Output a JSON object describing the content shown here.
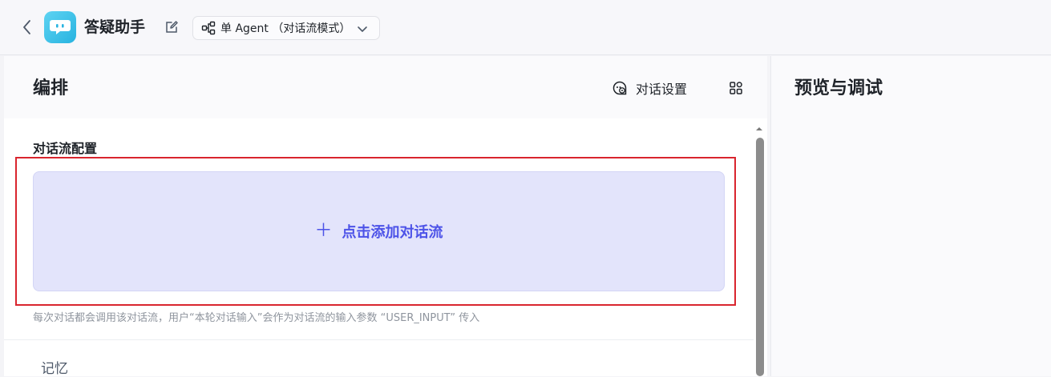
{
  "header": {
    "app_title": "答疑助手",
    "mode_label": "单 Agent （对话流模式）",
    "icons": {
      "back": "chevron-left-icon",
      "logo": "chat-bubble-logo",
      "edit": "edit-icon",
      "mode": "workflow-icon",
      "dropdown": "chevron-down-icon"
    }
  },
  "left_panel": {
    "title": "编排",
    "dialog_settings_label": "对话设置",
    "section_title": "对话流配置",
    "add_flow_label": "点击添加对话流",
    "hint": "每次对话都会调用该对话流，用户“本轮对话输入”会作为对话流的输入参数 “USER_INPUT” 传入",
    "memory_title": "记忆"
  },
  "right_panel": {
    "title": "预览与调试"
  },
  "colors": {
    "accent": "#4d53e8",
    "add_box_bg": "#e3e4fb",
    "highlight": "#d9252e",
    "logo": "#27b3e0"
  }
}
